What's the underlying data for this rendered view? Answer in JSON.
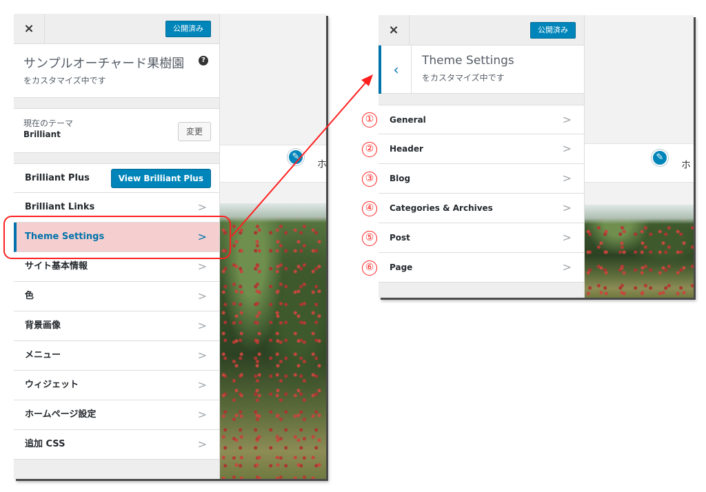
{
  "left_screen": {
    "close_icon": "×",
    "publish_label": "公開済み",
    "site_title": "サンプルオーチャード果樹園",
    "help_icon": "?",
    "customizing_label": "をカスタマイズ中です",
    "theme": {
      "caption": "現在のテーマ",
      "name": "Brilliant",
      "change_label": "変更"
    },
    "brilliant_plus": {
      "label": "Brilliant Plus",
      "button_label": "View Brilliant Plus"
    },
    "menu_items": [
      {
        "label": "Brilliant Links",
        "active": false
      },
      {
        "label": "Theme Settings",
        "active": true
      },
      {
        "label": "サイト基本情報",
        "active": false
      },
      {
        "label": "色",
        "active": false
      },
      {
        "label": "背景画像",
        "active": false
      },
      {
        "label": "メニュー",
        "active": false
      },
      {
        "label": "ウィジェット",
        "active": false
      },
      {
        "label": "ホームページ設定",
        "active": false
      },
      {
        "label": "追加 CSS",
        "active": false
      }
    ],
    "preview_text": "ホ"
  },
  "right_screen": {
    "close_icon": "×",
    "publish_label": "公開済み",
    "back_icon": "‹",
    "section_title": "Theme Settings",
    "customizing_label": "をカスタマイズ中です",
    "menu_items": [
      {
        "label": "General"
      },
      {
        "label": "Header"
      },
      {
        "label": "Blog"
      },
      {
        "label": "Categories & Archives"
      },
      {
        "label": "Post"
      },
      {
        "label": "Page"
      }
    ],
    "preview_text": "ホ"
  },
  "annotations": {
    "numbers": [
      "①",
      "②",
      "③",
      "④",
      "⑤",
      "⑥"
    ],
    "highlight_color": "#ff1e1e"
  },
  "colors": {
    "accent": "#0085ba",
    "active_bg": "#f5cfd0",
    "annotation": "#ff1e1e"
  }
}
